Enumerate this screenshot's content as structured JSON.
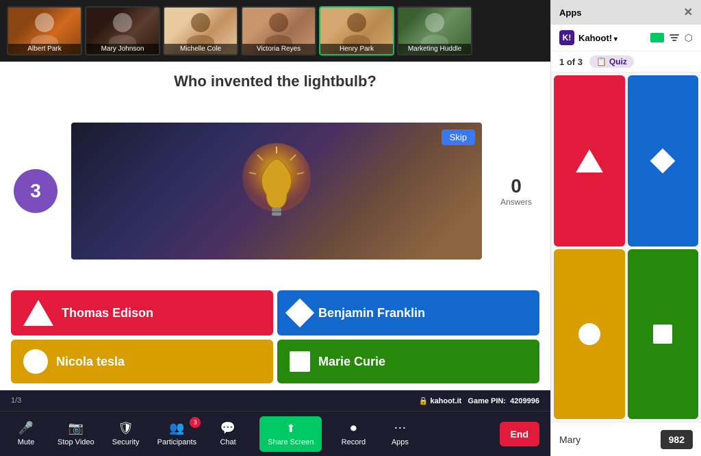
{
  "apps_panel": {
    "title": "Apps",
    "close_label": "✕"
  },
  "kahoot_app": {
    "logo_letter": "K!",
    "name": "Kahoot!",
    "quiz_counter": "1 of 3",
    "quiz_badge": "Quiz"
  },
  "question": {
    "text": "Who invented the lightbulb?",
    "timer": "3",
    "answers_count": "0",
    "answers_label": "Answers"
  },
  "answers": [
    {
      "id": "thomas",
      "text": "Thomas Edison",
      "color": "red",
      "shape": "triangle"
    },
    {
      "id": "benjamin",
      "text": "Benjamin Franklin",
      "color": "blue",
      "shape": "diamond"
    },
    {
      "id": "nicola",
      "text": "Nicola tesla",
      "color": "yellow",
      "shape": "circle"
    },
    {
      "id": "marie",
      "text": "Marie Curie",
      "color": "green",
      "shape": "square"
    }
  ],
  "footer": {
    "page_indicator": "1/3",
    "lock_icon": "🔒",
    "site": "kahoot.it",
    "pin_label": "Game PIN:",
    "pin": "4209996"
  },
  "toolbar": {
    "items": [
      {
        "id": "mute",
        "icon": "🎤",
        "label": "Mute",
        "caret": true
      },
      {
        "id": "video",
        "icon": "📷",
        "label": "Stop Video",
        "caret": true
      },
      {
        "id": "security",
        "icon": "🔒",
        "label": "Security"
      },
      {
        "id": "participants",
        "icon": "👥",
        "label": "Participants",
        "badge": "3"
      },
      {
        "id": "chat",
        "icon": "💬",
        "label": "Chat"
      },
      {
        "id": "share-screen",
        "icon": "↑",
        "label": "Share Screen",
        "highlighted": true
      },
      {
        "id": "record",
        "icon": "⏺",
        "label": "Record"
      },
      {
        "id": "apps",
        "icon": "⋯",
        "label": "Apps"
      }
    ],
    "end_label": "End"
  },
  "video_participants": [
    {
      "id": "albert",
      "name": "Albert Park"
    },
    {
      "id": "mary",
      "name": "Mary Johnson"
    },
    {
      "id": "michelle",
      "name": "Michelle Cole"
    },
    {
      "id": "victoria",
      "name": "Victoria Reyes"
    },
    {
      "id": "henry",
      "name": "Henry Park",
      "active": true
    },
    {
      "id": "marketing",
      "name": "Marketing Huddle"
    }
  ],
  "skip_label": "Skip",
  "score_bar": {
    "name": "Mary",
    "score": "982"
  }
}
